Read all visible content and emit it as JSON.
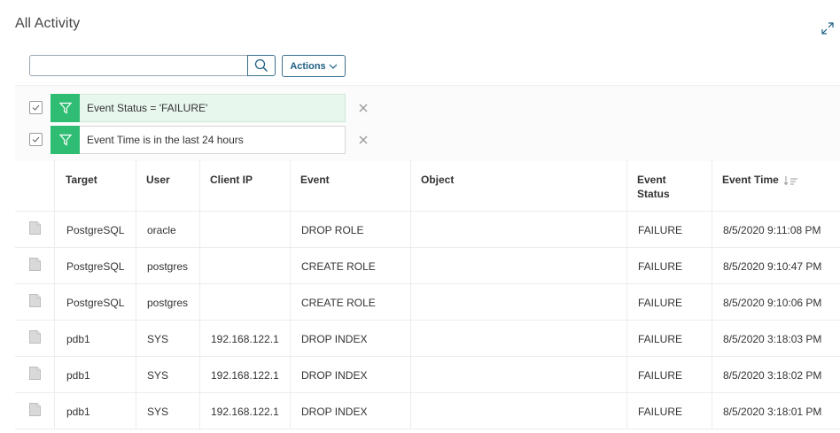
{
  "header": {
    "title": "All Activity"
  },
  "toolbar": {
    "search_value": "",
    "search_placeholder": "",
    "actions_label": "Actions"
  },
  "filters": [
    {
      "text": "Event Status = 'FAILURE'",
      "checked": true,
      "active": true
    },
    {
      "text": "Event Time is in the last 24 hours",
      "checked": true,
      "active": false
    }
  ],
  "table": {
    "columns": [
      "Target",
      "User",
      "Client IP",
      "Event",
      "Object",
      "Event Status",
      "Event Time"
    ],
    "rows": [
      [
        "PostgreSQL",
        "oracle",
        "",
        "DROP ROLE",
        "",
        "FAILURE",
        "8/5/2020 9:11:08 PM"
      ],
      [
        "PostgreSQL",
        "postgres",
        "",
        "CREATE ROLE",
        "",
        "FAILURE",
        "8/5/2020 9:10:47 PM"
      ],
      [
        "PostgreSQL",
        "postgres",
        "",
        "CREATE ROLE",
        "",
        "FAILURE",
        "8/5/2020 9:10:06 PM"
      ],
      [
        "pdb1",
        "SYS",
        "192.168.122.1",
        "DROP INDEX",
        "",
        "FAILURE",
        "8/5/2020 3:18:03 PM"
      ],
      [
        "pdb1",
        "SYS",
        "192.168.122.1",
        "DROP INDEX",
        "",
        "FAILURE",
        "8/5/2020 3:18:02 PM"
      ],
      [
        "pdb1",
        "SYS",
        "192.168.122.1",
        "DROP INDEX",
        "",
        "FAILURE",
        "8/5/2020 3:18:01 PM"
      ]
    ]
  },
  "colors": {
    "accent": "#1f5f86",
    "filter_green": "#2fbd73",
    "filter_active_bg": "#e8f7ee"
  },
  "icons": {
    "expand": "expand-icon",
    "search": "search-icon",
    "actions_caret": "chevron-down-icon",
    "filter": "funnel-icon",
    "remove": "close-icon",
    "row": "document-icon",
    "sort": "sort-descending-icon"
  }
}
